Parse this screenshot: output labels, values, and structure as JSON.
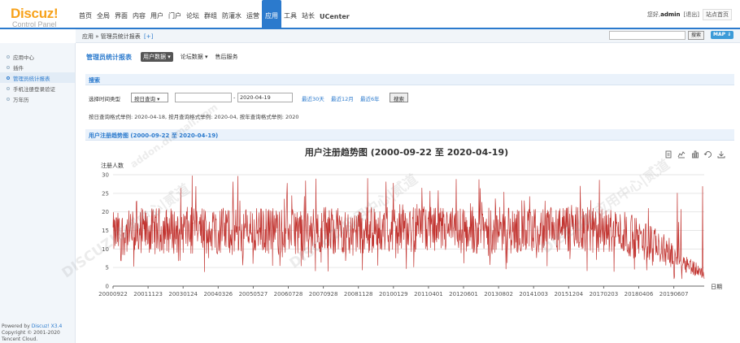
{
  "logo": {
    "name": "Discuz!",
    "subtitle": "Control Panel"
  },
  "topnav": [
    {
      "label": "首页"
    },
    {
      "label": "全局"
    },
    {
      "label": "界面"
    },
    {
      "label": "内容"
    },
    {
      "label": "用户"
    },
    {
      "label": "门户"
    },
    {
      "label": "论坛"
    },
    {
      "label": "群组"
    },
    {
      "label": "防灌水"
    },
    {
      "label": "运营"
    },
    {
      "label": "应用",
      "active": true
    },
    {
      "label": "工具"
    },
    {
      "label": "站长"
    },
    {
      "label": "UCenter"
    }
  ],
  "user": {
    "greeting": "您好,",
    "name": "admin",
    "logout": "[退出]",
    "home": "站点首页"
  },
  "breadcrumb": {
    "text": "应用 » 管理员统计报表",
    "plus": "[+]"
  },
  "topsearch": {
    "button": "搜索",
    "map": "MAP ⇓"
  },
  "sidebar": {
    "items": [
      {
        "label": "应用中心"
      },
      {
        "label": "插件"
      },
      {
        "label": "管理员统计报表",
        "active": true
      },
      {
        "label": "手机注册登录验证"
      },
      {
        "label": "万年历"
      }
    ],
    "footer": {
      "line1_prefix": "Powered by ",
      "line1_brand": "Discuz! X3.4",
      "line2": "Copyright © 2001-2020",
      "line3": "Tencent Cloud."
    }
  },
  "page": {
    "title": "管理员统计报表",
    "tabs": [
      {
        "label": "用户数据 ▾",
        "active": true
      },
      {
        "label": "论坛数据 ▾"
      },
      {
        "label": "售后服务"
      }
    ]
  },
  "search_section": {
    "title": "搜索"
  },
  "filter": {
    "label": "选择时间类型",
    "type_value": "按日查询 ▾",
    "date_end": "2020-04-19",
    "quick": [
      "最近30天",
      "最近12月",
      "最近6年"
    ],
    "submit": "搜索",
    "example": "按日查询格式举例: 2020-04-18, 按月查询格式举例: 2020-04, 按年查询格式举例: 2020"
  },
  "trend_section": {
    "title": "用户注册趋势图 (2000-09-22 至 2020-04-19)"
  },
  "toolbox_icons": [
    "data-view-icon",
    "line-chart-icon",
    "bar-chart-icon",
    "restore-icon",
    "download-icon"
  ],
  "watermark": [
    "DISCUZ!应用中心|贰道",
    "addon.dismall.com"
  ],
  "chart_data": {
    "type": "line",
    "title": "用户注册趋势图 (2000-09-22 至 2020-04-19)",
    "ylabel": "注册人数",
    "xlabel": "日期",
    "ylim": [
      0,
      30
    ],
    "yticks": [
      0,
      5,
      10,
      15,
      20,
      25,
      30
    ],
    "x_range": [
      "2000-09-22",
      "2020-04-19"
    ],
    "xtick_labels": [
      "20000922",
      "20011123",
      "20030124",
      "20040326",
      "20050527",
      "20060728",
      "20070928",
      "20081128",
      "20100129",
      "20110401",
      "20120601",
      "20130802",
      "20141003",
      "20151204",
      "20170203",
      "20180406",
      "20190607"
    ],
    "series": [
      {
        "color": "#c23531",
        "daily_values_summary": "daily registrations, mostly 9–21, peaks to ~30, tapering to ~3 by 2020",
        "trend_points": [
          {
            "x": "2000-09-22",
            "y": 14
          },
          {
            "x": "2002-06-01",
            "y": 15
          },
          {
            "x": "2004-01-01",
            "y": 15
          },
          {
            "x": "2006-01-01",
            "y": 15
          },
          {
            "x": "2008-01-01",
            "y": 15
          },
          {
            "x": "2010-01-01",
            "y": 15
          },
          {
            "x": "2012-01-01",
            "y": 15
          },
          {
            "x": "2014-01-01",
            "y": 15
          },
          {
            "x": "2016-01-01",
            "y": 15
          },
          {
            "x": "2017-06-01",
            "y": 15
          },
          {
            "x": "2018-06-01",
            "y": 12
          },
          {
            "x": "2019-06-01",
            "y": 8
          },
          {
            "x": "2020-04-19",
            "y": 3
          }
        ],
        "band_low": 9,
        "band_high": 21,
        "spike_max": 30
      }
    ],
    "grid": true,
    "legend": "none"
  }
}
